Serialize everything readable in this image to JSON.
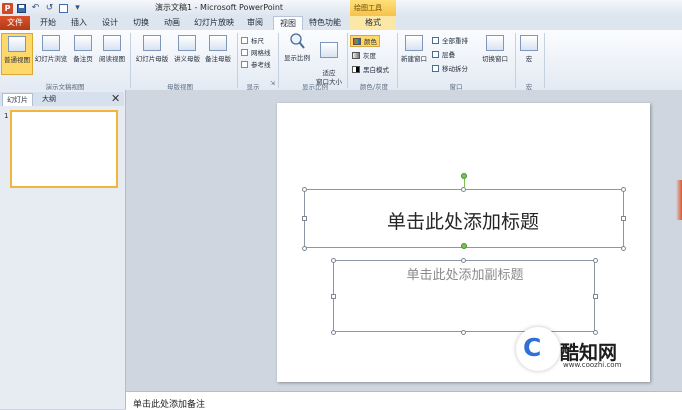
{
  "window": {
    "title": "演示文稿1 - Microsoft PowerPoint",
    "app_icon": "P"
  },
  "qat": {
    "icons": [
      "save-icon",
      "undo-icon",
      "redo-icon",
      "new-slide-icon",
      "customize-icon"
    ]
  },
  "contextual": {
    "group": "绘图工具"
  },
  "tabs": {
    "file": "文件",
    "home": "开始",
    "insert": "插入",
    "design": "设计",
    "transitions": "切换",
    "animations": "动画",
    "slideshow": "幻灯片放映",
    "review": "审阅",
    "view": "视图",
    "special": "特色功能",
    "format": "格式"
  },
  "ribbon": {
    "presentation_views": {
      "label": "演示文稿视图",
      "normal": "普通视图",
      "sorter": "幻灯片浏览",
      "notes": "备注页",
      "reading": "阅读视图"
    },
    "master_views": {
      "label": "母版视图",
      "slide_master": "幻灯片母版",
      "handout_master": "讲义母版",
      "notes_master": "备注母版"
    },
    "show": {
      "label": "显示",
      "ruler": "标尺",
      "gridlines": "网格线",
      "guides": "参考线"
    },
    "zoom": {
      "label": "显示比例",
      "zoom": "显示比例",
      "fit": "适应\n窗口大小"
    },
    "color": {
      "label": "颜色/灰度",
      "color": "颜色",
      "gray": "灰度",
      "bw": "黑白模式"
    },
    "window": {
      "label": "窗口",
      "new_window": "新建窗口",
      "arrange_all": "全部重排",
      "cascade": "层叠",
      "move_split": "移动拆分",
      "switch": "切换窗口"
    },
    "macros": {
      "label": "宏",
      "macro": "宏"
    }
  },
  "left_pane": {
    "tab_slides": "幻灯片",
    "tab_outline": "大纲",
    "close": "✕",
    "slide_number": "1"
  },
  "slide": {
    "title_placeholder": "单击此处添加标题",
    "subtitle_placeholder": "单击此处添加副标题"
  },
  "notes": {
    "placeholder": "单击此处添加备注"
  },
  "watermark": {
    "brand": "酷知网",
    "url": "www.coozhi.com",
    "logo_letter": "C"
  }
}
